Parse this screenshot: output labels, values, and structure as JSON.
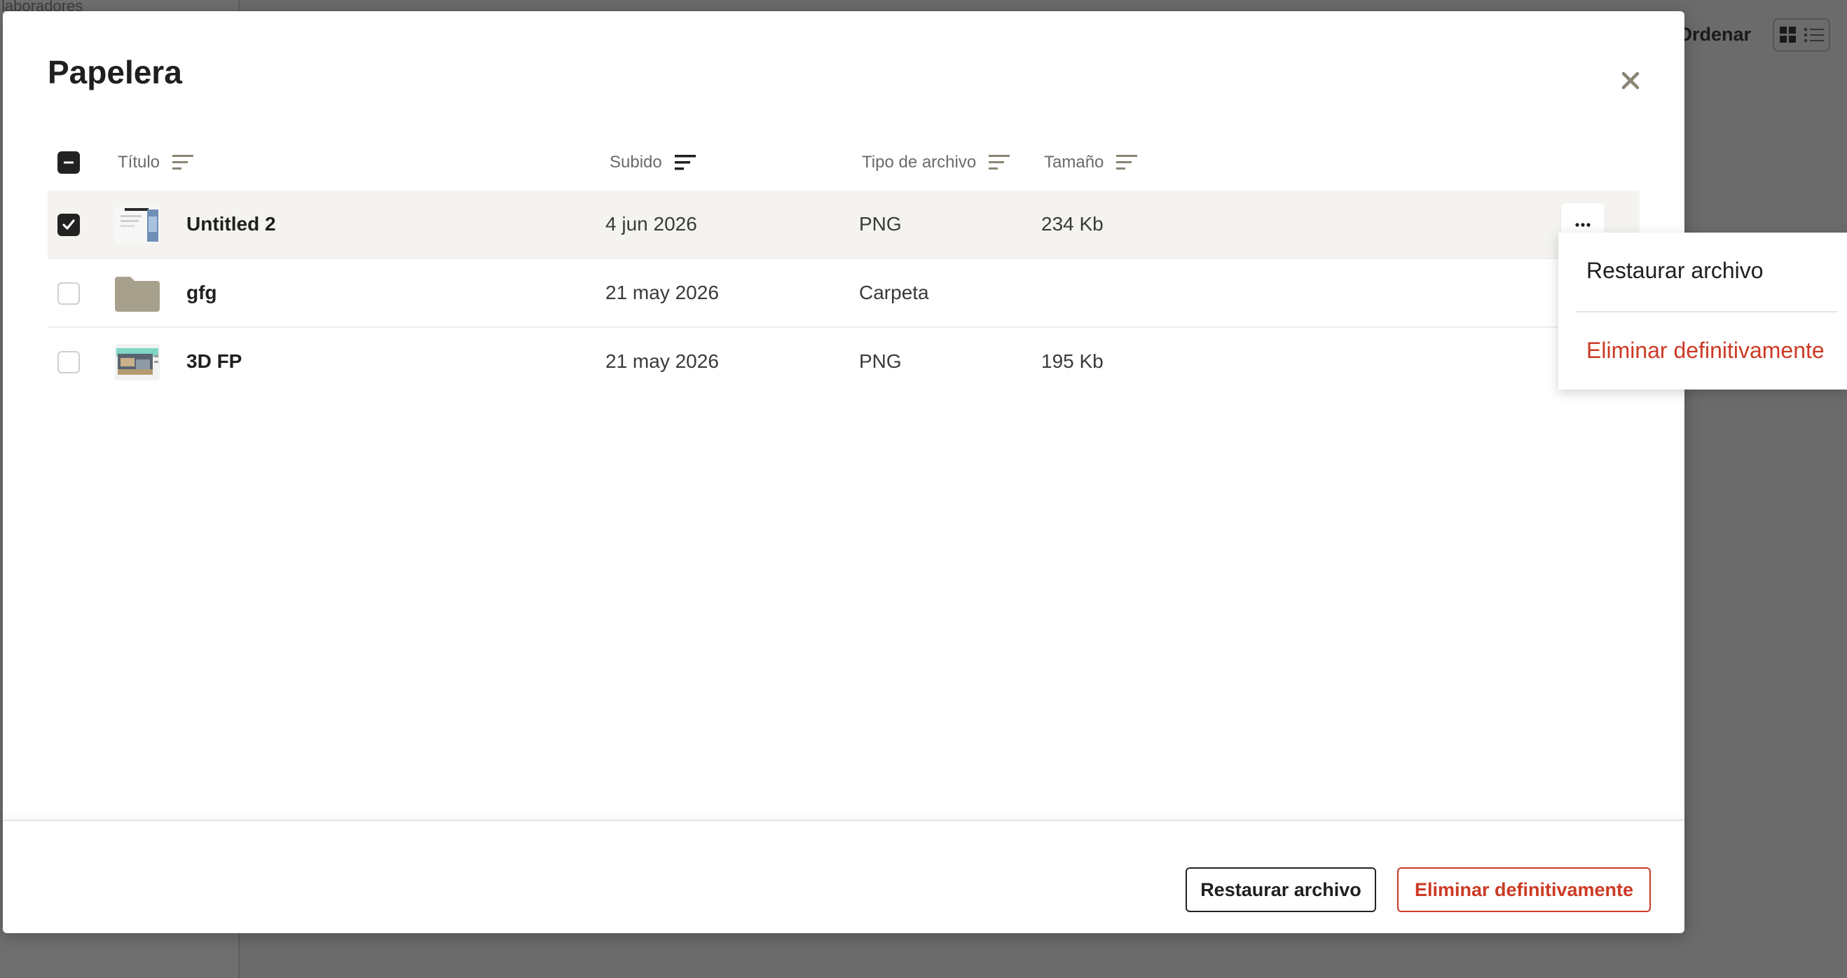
{
  "background": {
    "sidebar_label": "laboradores",
    "sort_label": "Ordenar"
  },
  "modal": {
    "title": "Papelera",
    "columns": {
      "title": "Título",
      "uploaded": "Subido",
      "type": "Tipo de archivo",
      "size": "Tamaño"
    },
    "rows": [
      {
        "title": "Untitled 2",
        "uploaded": "4 jun 2026",
        "type": "PNG",
        "size": "234 Kb",
        "selected": true
      },
      {
        "title": "gfg",
        "uploaded": "21 may 2026",
        "type": "Carpeta",
        "size": "",
        "selected": false
      },
      {
        "title": "3D FP",
        "uploaded": "21 may 2026",
        "type": "PNG",
        "size": "195 Kb",
        "selected": false
      }
    ],
    "footer": {
      "restore_label": "Restaurar archivo",
      "delete_label": "Eliminar definitivamente"
    }
  },
  "dropdown": {
    "restore_label": "Restaurar archivo",
    "delete_label": "Eliminar definitivamente"
  },
  "colors": {
    "danger": "#cc3a24",
    "folder": "#a7a08d",
    "selected_row": "#f4f3ef",
    "sort_icon": "#8a8574"
  }
}
